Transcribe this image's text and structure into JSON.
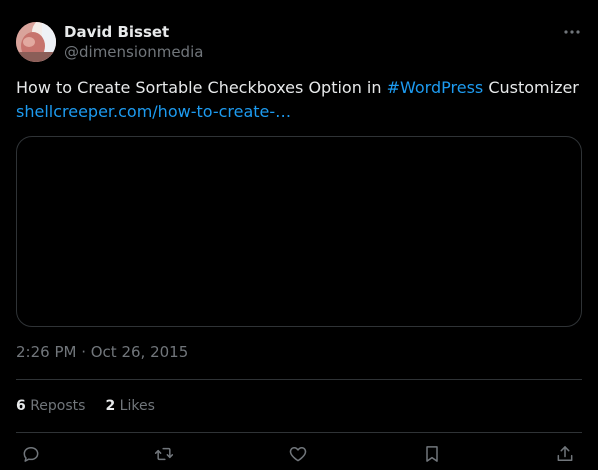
{
  "author": {
    "name": "David Bisset",
    "handle": "@dimensionmedia",
    "avatar_icon": "profile-photo"
  },
  "tweet": {
    "text_prefix": "How to Create Sortable Checkboxes Option in ",
    "hashtag": "#WordPress",
    "text_suffix": " Customizer",
    "link": "shellcreeper.com/how-to-create-…",
    "timestamp": "2:26 PM · Oct 26, 2015"
  },
  "stats": {
    "reposts_count": "6",
    "reposts_label": "Reposts",
    "likes_count": "2",
    "likes_label": "Likes"
  },
  "actions": [
    "reply-icon",
    "repost-icon",
    "like-icon",
    "bookmark-icon",
    "share-icon"
  ],
  "colors": {
    "background": "#000000",
    "text": "#e7e9ea",
    "muted": "#71767b",
    "accent": "#1d9bf0",
    "border": "#2f3336"
  }
}
